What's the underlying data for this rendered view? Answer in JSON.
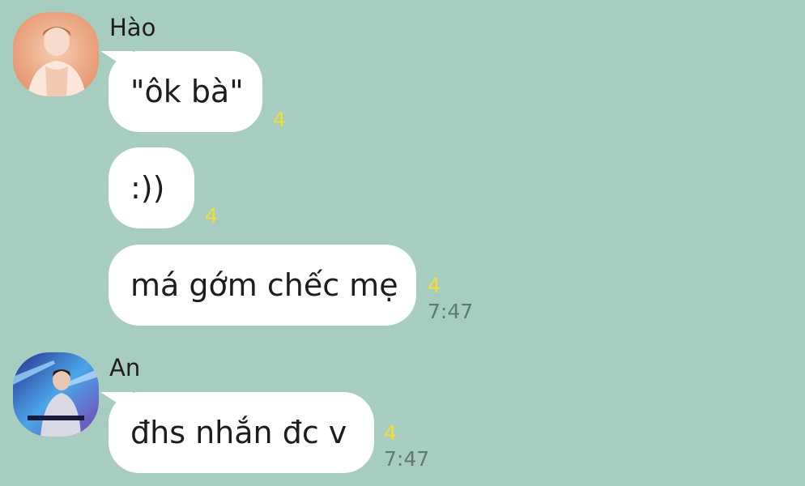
{
  "colors": {
    "background": "#a6cdbf",
    "bubble": "#ffffff",
    "read_count": "#f2dd32",
    "timestamp": "#62796f"
  },
  "groups": [
    {
      "sender": "Hào",
      "avatar": "orange-toned-photo-avatar",
      "messages": [
        {
          "text": "\"ôk bà\"",
          "read_count": "4",
          "time": ""
        },
        {
          "text": ":))",
          "read_count": "4",
          "time": ""
        },
        {
          "text": "má gớm chếc mẹ",
          "read_count": "4",
          "time": "7:47"
        }
      ]
    },
    {
      "sender": "An",
      "avatar": "stage-concert-photo-avatar",
      "messages": [
        {
          "text": "đhs nhắn đc v",
          "read_count": "4",
          "time": "7:47"
        }
      ]
    }
  ]
}
